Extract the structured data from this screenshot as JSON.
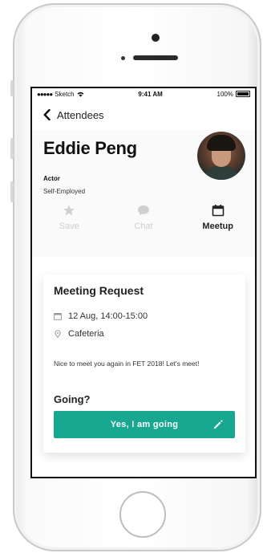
{
  "status_bar": {
    "carrier": "Sketch",
    "time": "9:41 AM",
    "battery": "100%"
  },
  "nav": {
    "back_label": "Attendees"
  },
  "profile": {
    "name": "Eddie Peng",
    "role": "Actor",
    "company": "Self-Employed"
  },
  "actions": [
    {
      "label": "Save",
      "icon": "star-icon",
      "enabled": false
    },
    {
      "label": "Chat",
      "icon": "chat-bubble-icon",
      "enabled": false
    },
    {
      "label": "Meetup",
      "icon": "calendar-icon",
      "enabled": true
    }
  ],
  "meeting": {
    "title": "Meeting Request",
    "date_time": "12 Aug, 14:00-15:00",
    "location": "Cafeteria",
    "message": "Nice to meet you again in FET 2018! Let's meet!",
    "going_label": "Going?",
    "button_label": "Yes, I am going"
  },
  "colors": {
    "accent": "#18a892",
    "disabled": "#d0d0d0",
    "text": "#222222"
  }
}
